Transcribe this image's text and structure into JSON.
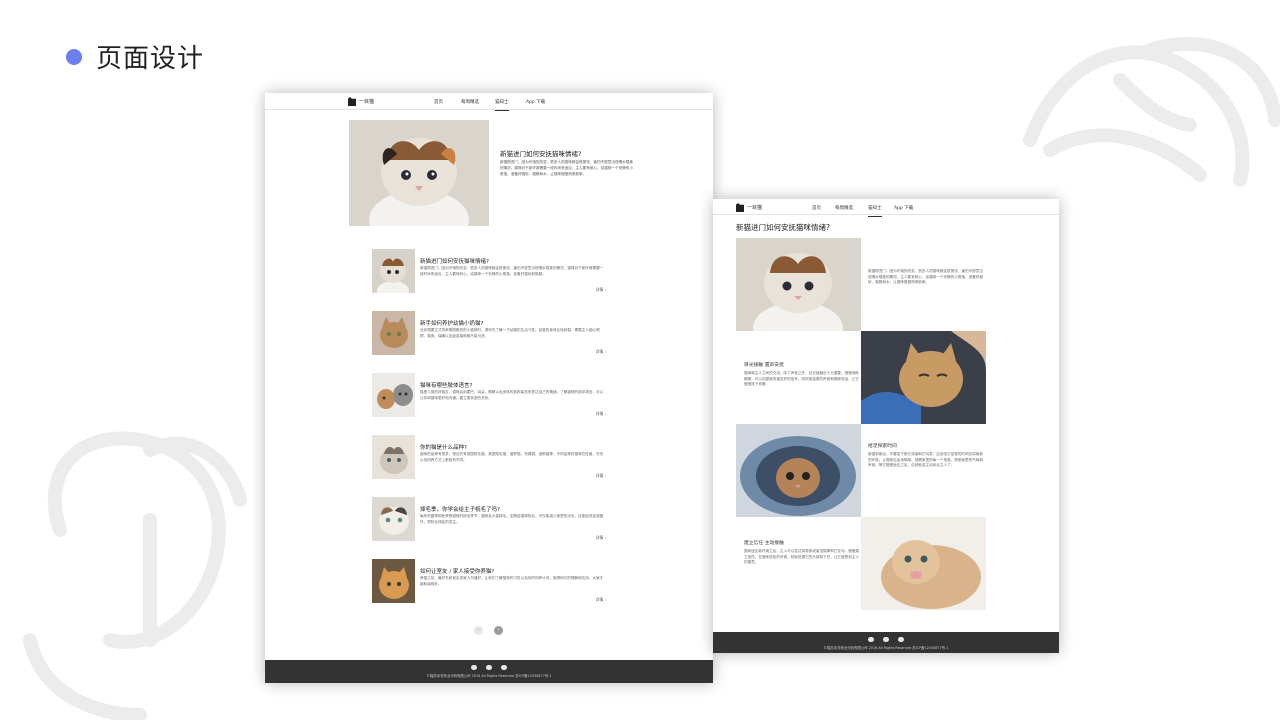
{
  "slide": {
    "title": "页面设计",
    "accent_color": "#6a7ff0"
  },
  "site": {
    "logo_text": "一目猫",
    "nav": [
      "首页",
      "每周精选",
      "猫知士",
      "App 下载"
    ],
    "active_nav": "猫知士",
    "footer_icons": [
      "wechat-icon",
      "weibo-icon",
      "qq-icon"
    ],
    "footer_text": "©喵苏米非商业代码有限公司 2016 All Rights Reserved 苏ICP备12030877号-1",
    "footer_text_b": "©喵苏米非商业代码有限公司 2016 All Rights Reserved 苏ICP备12030877号-1"
  },
  "page_a": {
    "hero": {
      "title": "新猫进门如何安抚猫咪情绪?",
      "body": "新猫刚进门，因为环境的改变，很多人的猫咪都会很紧张，害怕不愿意出现喝水喂食的情况。猫咪对于新环境需要一段时间来适应，主人要有耐心，给猫咪一个安静的小角落，准备好猫砂、猫粮和水，让猫咪慢慢熟悉新家。"
    },
    "articles": [
      {
        "title": "新猫进门如何安抚猫咪情绪?",
        "body": "新猫刚进门，因为环境的改变，很多人的猫咪都会很紧张，害怕不愿意出现喝水喂食的情况。猫咪对于新环境需要一段时间来适应，主人要有耐心，给猫咪一个安静的小角落，准备好猫砂和猫粮。",
        "more": "详情"
      },
      {
        "title": "新手如何养护幼猫小奶猫?",
        "body": "当你想要正式饲养刚刚断奶的小猫咪时，请你先了解一下幼猫的生活习性。幼猫的身体比较娇弱，需要主人细心照顾，喂食、保暖以及疫苗接种都不能马虎。",
        "more": "详情"
      },
      {
        "title": "猫咪有哪些肢体语言?",
        "body": "猫是人类的好朋友，猫咪会用尾巴、耳朵、眼睛以及身体的各种姿态来表达自己的情绪。了解猫咪的肢体语言，可以让你和猫咪更好地沟通，建立更亲密的关系。",
        "more": "详情"
      },
      {
        "title": "你的猫是什么品种?",
        "body": "猫咪的品种有很多，常见的有英国短毛猫、美国短毛猫、暹罗猫、布偶猫、波斯猫等，不同品种的猫咪在性格、外形以及饲养方式上都各有不同。",
        "more": "详情"
      },
      {
        "title": "掉毛季，你学会给主子梳毛了吗?",
        "body": "每年的春季和秋季是猫咪的换毛季节，猫咪会大量掉毛。定期给猫咪梳毛，不仅能减少家里的浮毛，还能促进血液循环，预防毛球症的发生。",
        "more": "详情"
      },
      {
        "title": "如何让室友 / 家人接受你养猫?",
        "body": "养猫之前，最好先和室友或家人沟通好，让他们了解猫咪的习性以及你的饲养计划，取得他们的理解和支持，大家才能和谐相处。",
        "more": "详情"
      }
    ],
    "pager_prev": "‹",
    "pager_next": "›"
  },
  "page_b": {
    "title": "新猫进门如何安抚猫咪情绪?",
    "sections": [
      {
        "heading": "",
        "body": "新猫刚进门，因为环境的改变，很多人的猫咪都会很紧张，害怕不愿意出现喝水喂食的情况。主人要有耐心，给猫咪一个安静的小角落，准备好猫砂、猫粮和水，让猫咪慢慢熟悉新家。"
      },
      {
        "heading": "目光接触  置声安抚",
        "body": "猫咪和主人之间的交流，除了声音之外，目光接触也十分重要。慢慢地眨眼睛，可以向猫咪传递友好的信号。同时用温柔的声音和猫咪说话，让它慢慢放下戒备。"
      },
      {
        "heading": "给足探索时间",
        "body": "新猫到家后，不要急于抱它或者和它玩耍，应该给它足够的时间去探索新的环境。让猫咪自由地嗅闻、观察家里的每一个角落，熟悉家里的气味和声音。等它慢慢适应之后，自然就会主动亲近主人了。"
      },
      {
        "heading": "建立信任  主动接触",
        "body": "猫咪适应新环境之后，主人可以尝试用零食或者逗猫棒和它互动，慢慢建立信任。在猫咪放松的时候，轻轻抚摸它的头部和下巴，让它感受到主人的善意。"
      }
    ]
  }
}
